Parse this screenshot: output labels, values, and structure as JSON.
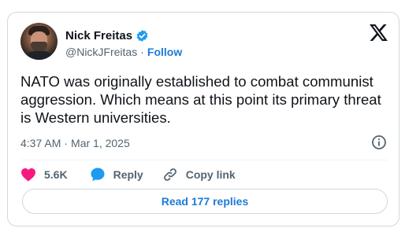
{
  "author": {
    "display_name": "Nick Freitas",
    "handle": "@NickJFreitas",
    "separator": "·",
    "follow_label": "Follow"
  },
  "tweet": {
    "text": "NATO was originally established to combat communist aggression. Which means at this point its primary threat is Western universities.",
    "time": "4:37 AM",
    "separator": "·",
    "date": "Mar 1, 2025"
  },
  "actions": {
    "like_count": "5.6K",
    "reply_label": "Reply",
    "copy_link_label": "Copy link"
  },
  "read_replies_label": "Read 177 replies",
  "icons": {
    "verified": "verified-badge-icon",
    "logo": "x-logo-icon",
    "info": "info-icon",
    "like": "heart-icon",
    "reply": "speech-bubble-icon",
    "copy_link": "link-icon"
  },
  "colors": {
    "accent_blue": "#1d7bd8",
    "like_pink": "#f91880",
    "verified_blue": "#1d9bf0",
    "muted_text": "#536471",
    "border": "#cfd9de"
  }
}
